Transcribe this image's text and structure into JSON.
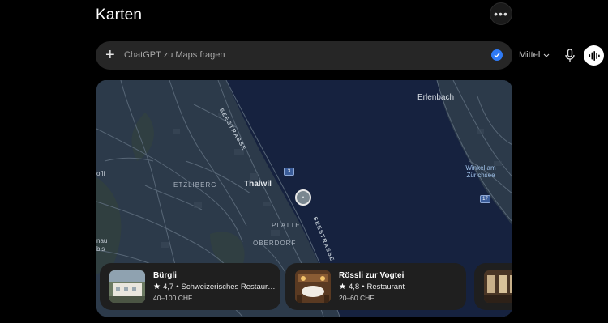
{
  "header": {
    "title": "Karten",
    "more_icon": "ellipsis-icon"
  },
  "composer": {
    "placeholder": "ChatGPT zu Maps fragen",
    "model_label": "Mittel",
    "icons": [
      "plus-icon",
      "check-icon",
      "chevron-down-icon",
      "microphone-icon",
      "voice-mode-icon"
    ],
    "accent": "#2f7af5"
  },
  "map": {
    "labels": {
      "erlenbach": "Erlenbach",
      "winkel": "Winkel am Zürichsee",
      "etzliberg": "ETZLIBERG",
      "thalwil": "Thalwil",
      "platte": "PLATTE",
      "oberdorf": "OBERDORF",
      "seestrasse_top": "SEESTRASSE",
      "seestrasse_bottom": "SEESTRASSE",
      "edge_left_1": "ofli",
      "edge_left_2": "nau\nbis"
    },
    "route_shields": [
      "3",
      "17"
    ],
    "colors": {
      "water": "#16223f",
      "land": "#2c3a4a",
      "roads": "#5d6c7c"
    }
  },
  "places": [
    {
      "name": "Bürgli",
      "rating": "4,7",
      "category": "Schweizerisches Restaur…",
      "price": "40–100 CHF"
    },
    {
      "name": "Rössli zur Vogtei",
      "rating": "4,8",
      "category": "Restaurant",
      "price": "20–60 CHF"
    }
  ]
}
